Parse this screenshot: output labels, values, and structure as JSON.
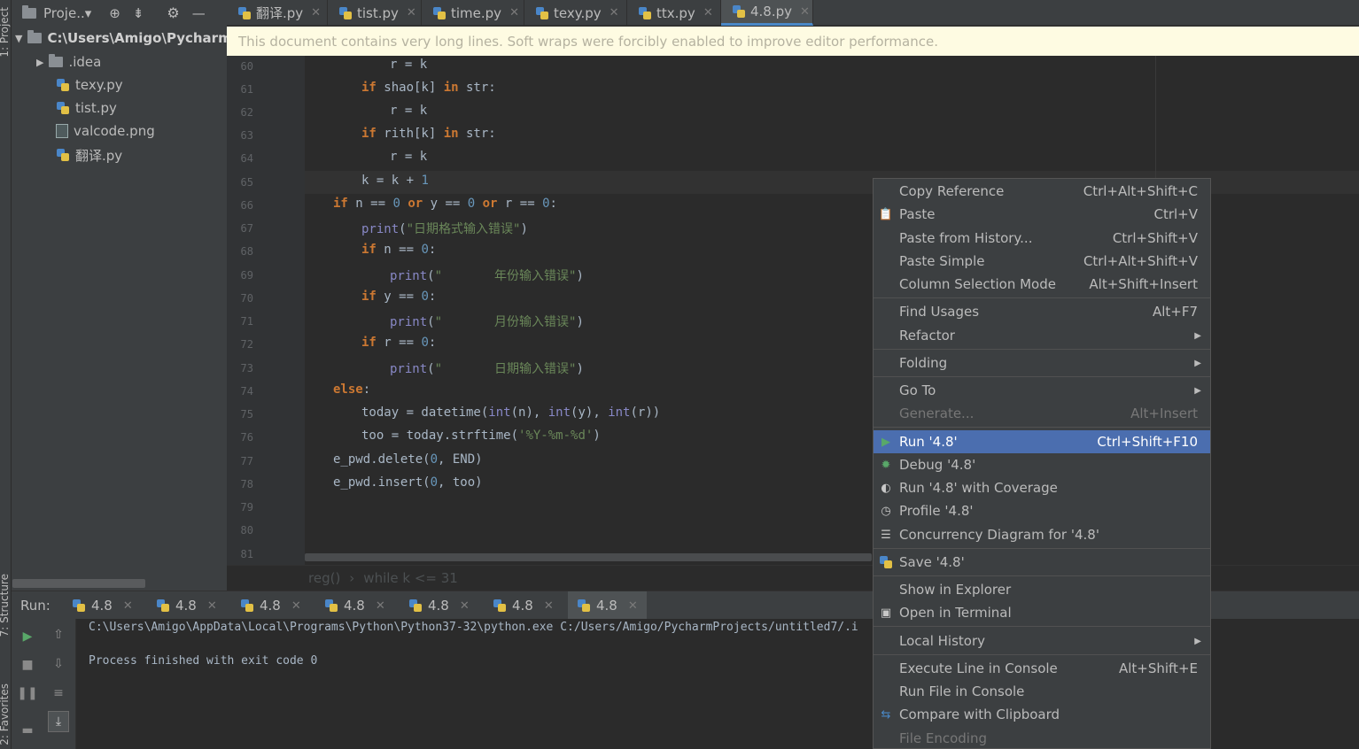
{
  "project_panel": {
    "title": "Proje..▾",
    "side_label": "1: Project",
    "tree": [
      {
        "label": "C:\\Users\\Amigo\\Pycharm",
        "type": "folder-root"
      },
      {
        "label": ".idea",
        "type": "folder"
      },
      {
        "label": "texy.py",
        "type": "py"
      },
      {
        "label": "tist.py",
        "type": "py"
      },
      {
        "label": "valcode.png",
        "type": "image"
      },
      {
        "label": "翻译.py",
        "type": "py"
      }
    ]
  },
  "left_labels": {
    "structure": "7: Structure",
    "favorites": "2: Favorites"
  },
  "tabs": [
    {
      "label": "翻译.py"
    },
    {
      "label": "tist.py"
    },
    {
      "label": "time.py"
    },
    {
      "label": "texy.py"
    },
    {
      "label": "ttx.py"
    },
    {
      "label": "4.8.py",
      "active": true
    }
  ],
  "banner": "This document contains very long lines. Soft wraps were forcibly enabled to improve editor performance.",
  "editor": {
    "line_numbers": [
      "60",
      "61",
      "62",
      "63",
      "64",
      "65",
      "66",
      "67",
      "68",
      "69",
      "70",
      "71",
      "72",
      "73",
      "74",
      "75",
      "76",
      "77",
      "78",
      "79",
      "80",
      "81"
    ],
    "breadcrumb": [
      "reg()",
      "›",
      "while k <= 31"
    ]
  },
  "run_panel": {
    "label": "Run:",
    "tabs": [
      "4.8",
      "4.8",
      "4.8",
      "4.8",
      "4.8",
      "4.8",
      "4.8"
    ],
    "console": [
      "C:\\Users\\Amigo\\AppData\\Local\\Programs\\Python\\Python37-32\\python.exe C:/Users/Amigo/PycharmProjects/untitled7/.i",
      "",
      "Process finished with exit code 0"
    ]
  },
  "context_menu": {
    "items": [
      {
        "label": "Copy Reference",
        "shortcut": "Ctrl+Alt+Shift+C"
      },
      {
        "label": "Paste",
        "shortcut": "Ctrl+V",
        "icon": "clipboard-icon"
      },
      {
        "label": "Paste from History...",
        "shortcut": "Ctrl+Shift+V"
      },
      {
        "label": "Paste Simple",
        "shortcut": "Ctrl+Alt+Shift+V"
      },
      {
        "label": "Column Selection Mode",
        "shortcut": "Alt+Shift+Insert"
      },
      {
        "label": "Find Usages",
        "shortcut": "Alt+F7"
      },
      {
        "label": "Refactor",
        "shortcut": ""
      },
      {
        "label": "Folding",
        "shortcut": ""
      },
      {
        "label": "Go To",
        "shortcut": ""
      },
      {
        "label": "Generate...",
        "shortcut": "Alt+Insert"
      },
      {
        "label": "Run '4.8'",
        "shortcut": "Ctrl+Shift+F10"
      },
      {
        "label": "Debug '4.8'",
        "shortcut": ""
      },
      {
        "label": "Run '4.8' with Coverage",
        "shortcut": ""
      },
      {
        "label": "Profile '4.8'",
        "shortcut": ""
      },
      {
        "label": "Concurrency Diagram for '4.8'",
        "shortcut": ""
      },
      {
        "label": "Save '4.8'",
        "shortcut": ""
      },
      {
        "label": "Show in Explorer",
        "shortcut": ""
      },
      {
        "label": "Open in Terminal",
        "shortcut": ""
      },
      {
        "label": "Local History",
        "shortcut": ""
      },
      {
        "label": "Execute Line in Console",
        "shortcut": "Alt+Shift+E"
      },
      {
        "label": "Run File in Console",
        "shortcut": ""
      },
      {
        "label": "Compare with Clipboard",
        "shortcut": ""
      },
      {
        "label": "File Encoding",
        "shortcut": ""
      }
    ]
  },
  "colors": {
    "selection": "#4b6eaf",
    "background": "#2b2b2b",
    "panel": "#3c3f41",
    "banner": "#fefbe2"
  }
}
